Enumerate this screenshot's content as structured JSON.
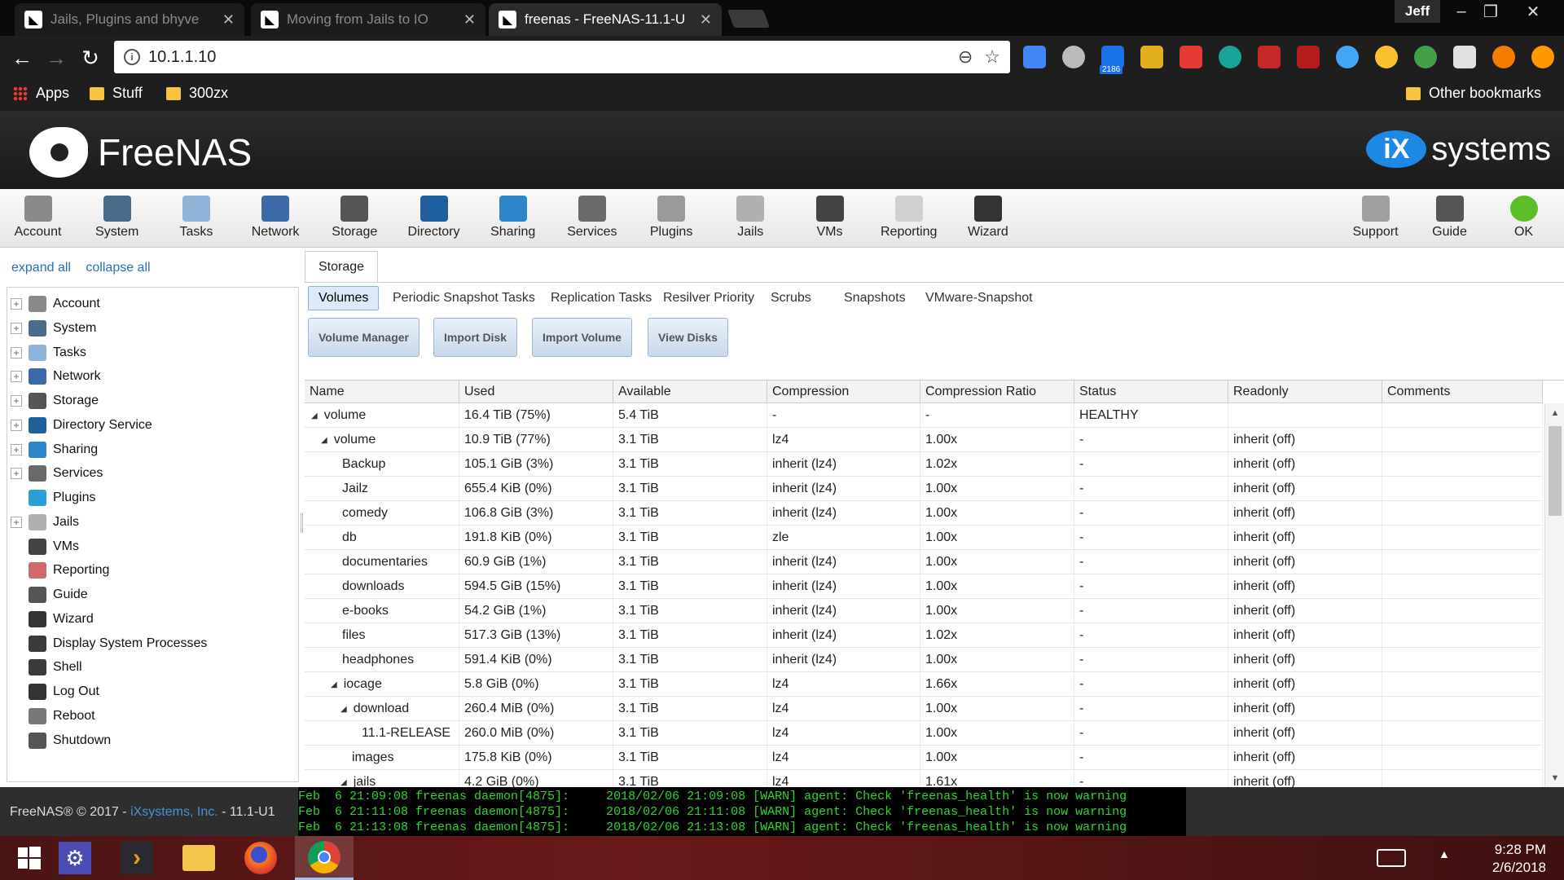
{
  "browser": {
    "tabs": [
      {
        "title": "Jails, Plugins and bhyve",
        "active": false
      },
      {
        "title": "Moving from Jails to IO",
        "active": false
      },
      {
        "title": "freenas - FreeNAS-11.1-U",
        "active": true
      }
    ],
    "user": "Jeff",
    "url": "10.1.1.10",
    "extension_badge_count": "2186",
    "bookmarks": [
      "Apps",
      "Stuff",
      "300zx"
    ],
    "other_bookmarks": "Other bookmarks"
  },
  "header": {
    "brand": "FreeNAS",
    "partner": "systems",
    "partner_mark": "iX"
  },
  "topnav": [
    {
      "label": "Account",
      "color": "#8a8a8a"
    },
    {
      "label": "System",
      "color": "#4a6b8a"
    },
    {
      "label": "Tasks",
      "color": "#8fb3d9"
    },
    {
      "label": "Network",
      "color": "#3a6aa8"
    },
    {
      "label": "Storage",
      "color": "#555555"
    },
    {
      "label": "Directory",
      "color": "#1f5f9e"
    },
    {
      "label": "Sharing",
      "color": "#2c86c9"
    },
    {
      "label": "Services",
      "color": "#6a6a6a"
    },
    {
      "label": "Plugins",
      "color": "#9a9a9a"
    },
    {
      "label": "Jails",
      "color": "#b0b0b0"
    },
    {
      "label": "VMs",
      "color": "#444444"
    },
    {
      "label": "Reporting",
      "color": "#d0d0d0"
    },
    {
      "label": "Wizard",
      "color": "#333333"
    }
  ],
  "topnav_right": [
    {
      "label": "Support",
      "color": "#a0a0a0"
    },
    {
      "label": "Guide",
      "color": "#555555"
    },
    {
      "label": "OK",
      "color": "#5cbf2a"
    }
  ],
  "tree": {
    "expand_all": "expand all",
    "collapse_all": "collapse all",
    "items": [
      {
        "label": "Account",
        "expandable": true,
        "color": "#8a8a8a"
      },
      {
        "label": "System",
        "expandable": true,
        "color": "#4a6b8a"
      },
      {
        "label": "Tasks",
        "expandable": true,
        "color": "#8fb3d9"
      },
      {
        "label": "Network",
        "expandable": true,
        "color": "#3a6aa8"
      },
      {
        "label": "Storage",
        "expandable": true,
        "color": "#555555"
      },
      {
        "label": "Directory Service",
        "expandable": true,
        "color": "#1f5f9e"
      },
      {
        "label": "Sharing",
        "expandable": true,
        "color": "#2c86c9"
      },
      {
        "label": "Services",
        "expandable": true,
        "color": "#6a6a6a"
      },
      {
        "label": "Plugins",
        "expandable": false,
        "color": "#2c9fd9"
      },
      {
        "label": "Jails",
        "expandable": true,
        "color": "#b0b0b0"
      },
      {
        "label": "VMs",
        "expandable": false,
        "color": "#444444"
      },
      {
        "label": "Reporting",
        "expandable": false,
        "color": "#d06a6a"
      },
      {
        "label": "Guide",
        "expandable": false,
        "color": "#555555"
      },
      {
        "label": "Wizard",
        "expandable": false,
        "color": "#333333"
      },
      {
        "label": "Display System Processes",
        "expandable": false,
        "color": "#3a3a3a"
      },
      {
        "label": "Shell",
        "expandable": false,
        "color": "#3a3a3a"
      },
      {
        "label": "Log Out",
        "expandable": false,
        "color": "#333333"
      },
      {
        "label": "Reboot",
        "expandable": false,
        "color": "#777777"
      },
      {
        "label": "Shutdown",
        "expandable": false,
        "color": "#555555"
      }
    ]
  },
  "storage": {
    "tab": "Storage",
    "subtabs": [
      "Volumes",
      "Periodic Snapshot Tasks",
      "Replication Tasks",
      "Resilver Priority",
      "Scrubs",
      "Snapshots",
      "VMware-Snapshot"
    ],
    "buttons": [
      "Volume Manager",
      "Import Disk",
      "Import Volume",
      "View Disks"
    ],
    "columns": [
      "Name",
      "Used",
      "Available",
      "Compression",
      "Compression Ratio",
      "Status",
      "Readonly",
      "Comments"
    ],
    "rows": [
      {
        "name": "volume",
        "level": 0,
        "expanded": true,
        "used": "16.4 TiB (75%)",
        "available": "5.4 TiB",
        "compression": "-",
        "ratio": "-",
        "status": "HEALTHY",
        "readonly": "",
        "comments": ""
      },
      {
        "name": "volume",
        "level": 1,
        "expanded": true,
        "used": "10.9 TiB (77%)",
        "available": "3.1 TiB",
        "compression": "lz4",
        "ratio": "1.00x",
        "status": "-",
        "readonly": "inherit (off)",
        "comments": ""
      },
      {
        "name": "Backup",
        "level": 2,
        "expanded": false,
        "used": "105.1 GiB (3%)",
        "available": "3.1 TiB",
        "compression": "inherit (lz4)",
        "ratio": "1.02x",
        "status": "-",
        "readonly": "inherit (off)",
        "comments": ""
      },
      {
        "name": "Jailz",
        "level": 2,
        "expanded": false,
        "used": "655.4 KiB (0%)",
        "available": "3.1 TiB",
        "compression": "inherit (lz4)",
        "ratio": "1.00x",
        "status": "-",
        "readonly": "inherit (off)",
        "comments": ""
      },
      {
        "name": "comedy",
        "level": 2,
        "expanded": false,
        "used": "106.8 GiB (3%)",
        "available": "3.1 TiB",
        "compression": "inherit (lz4)",
        "ratio": "1.00x",
        "status": "-",
        "readonly": "inherit (off)",
        "comments": ""
      },
      {
        "name": "db",
        "level": 2,
        "expanded": false,
        "used": "191.8 KiB (0%)",
        "available": "3.1 TiB",
        "compression": "zle",
        "ratio": "1.00x",
        "status": "-",
        "readonly": "inherit (off)",
        "comments": ""
      },
      {
        "name": "documentaries",
        "level": 2,
        "expanded": false,
        "used": "60.9 GiB (1%)",
        "available": "3.1 TiB",
        "compression": "inherit (lz4)",
        "ratio": "1.00x",
        "status": "-",
        "readonly": "inherit (off)",
        "comments": ""
      },
      {
        "name": "downloads",
        "level": 2,
        "expanded": false,
        "used": "594.5 GiB (15%)",
        "available": "3.1 TiB",
        "compression": "inherit (lz4)",
        "ratio": "1.00x",
        "status": "-",
        "readonly": "inherit (off)",
        "comments": ""
      },
      {
        "name": "e-books",
        "level": 2,
        "expanded": false,
        "used": "54.2 GiB (1%)",
        "available": "3.1 TiB",
        "compression": "inherit (lz4)",
        "ratio": "1.00x",
        "status": "-",
        "readonly": "inherit (off)",
        "comments": ""
      },
      {
        "name": "files",
        "level": 2,
        "expanded": false,
        "used": "517.3 GiB (13%)",
        "available": "3.1 TiB",
        "compression": "inherit (lz4)",
        "ratio": "1.02x",
        "status": "-",
        "readonly": "inherit (off)",
        "comments": ""
      },
      {
        "name": "headphones",
        "level": 2,
        "expanded": false,
        "used": "591.4 KiB (0%)",
        "available": "3.1 TiB",
        "compression": "inherit (lz4)",
        "ratio": "1.00x",
        "status": "-",
        "readonly": "inherit (off)",
        "comments": ""
      },
      {
        "name": "iocage",
        "level": 2,
        "expanded": true,
        "used": "5.8 GiB (0%)",
        "available": "3.1 TiB",
        "compression": "lz4",
        "ratio": "1.66x",
        "status": "-",
        "readonly": "inherit (off)",
        "comments": ""
      },
      {
        "name": "download",
        "level": 3,
        "expanded": true,
        "used": "260.4 MiB (0%)",
        "available": "3.1 TiB",
        "compression": "lz4",
        "ratio": "1.00x",
        "status": "-",
        "readonly": "inherit (off)",
        "comments": ""
      },
      {
        "name": "11.1-RELEASE",
        "level": 4,
        "expanded": false,
        "used": "260.0 MiB (0%)",
        "available": "3.1 TiB",
        "compression": "lz4",
        "ratio": "1.00x",
        "status": "-",
        "readonly": "inherit (off)",
        "comments": ""
      },
      {
        "name": "images",
        "level": 3,
        "expanded": false,
        "used": "175.8 KiB (0%)",
        "available": "3.1 TiB",
        "compression": "lz4",
        "ratio": "1.00x",
        "status": "-",
        "readonly": "inherit (off)",
        "comments": ""
      },
      {
        "name": "jails",
        "level": 3,
        "expanded": true,
        "used": "4.2 GiB (0%)",
        "available": "3.1 TiB",
        "compression": "lz4",
        "ratio": "1.61x",
        "status": "-",
        "readonly": "inherit (off)",
        "comments": ""
      }
    ]
  },
  "footer": {
    "copyright": "FreeNAS® © 2017 - ",
    "company": "iXsystems, Inc.",
    "version": " - 11.1-U1",
    "console": [
      "Feb  6 21:09:08 freenas daemon[4875]:     2018/02/06 21:09:08 [WARN] agent: Check 'freenas_health' is now warning",
      "Feb  6 21:11:08 freenas daemon[4875]:     2018/02/06 21:11:08 [WARN] agent: Check 'freenas_health' is now warning",
      "Feb  6 21:13:08 freenas daemon[4875]:     2018/02/06 21:13:08 [WARN] agent: Check 'freenas_health' is now warning"
    ]
  },
  "taskbar": {
    "time": "9:28 PM",
    "date": "2/6/2018"
  }
}
